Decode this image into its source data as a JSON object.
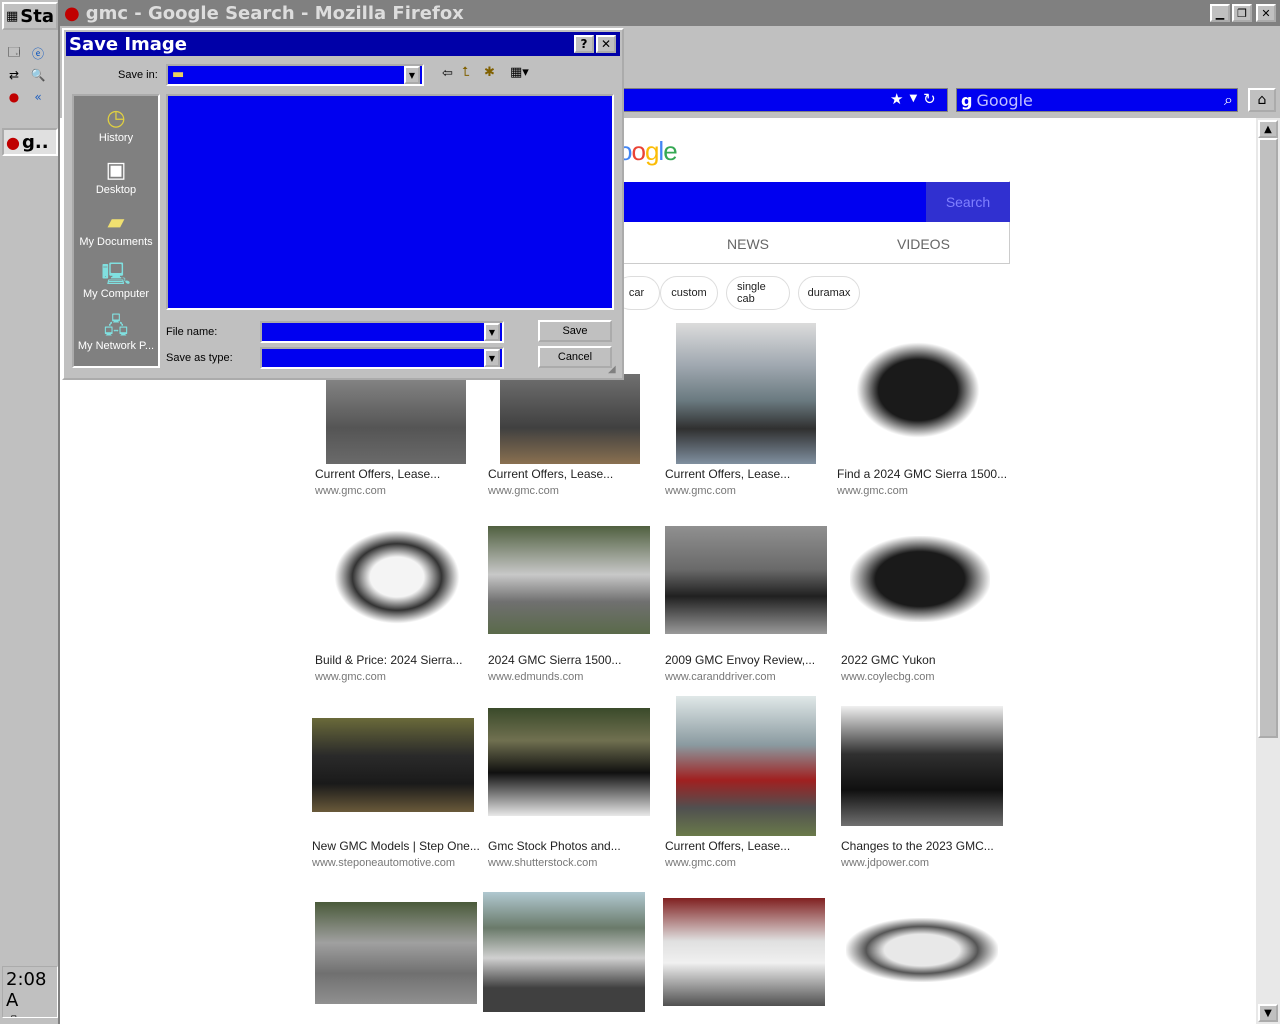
{
  "taskbar": {
    "start_label": "Sta",
    "task_label": "g..",
    "clock": "2:08 A"
  },
  "browser": {
    "window_title": "gmc - Google Search - Mozilla Firefox",
    "search_placeholder": "Google"
  },
  "google": {
    "logo": "Google",
    "search_button": "Search",
    "tabs": [
      "NEWS",
      "VIDEOS"
    ],
    "chips": [
      "car",
      "custom",
      "single cab",
      "duramax"
    ],
    "results": [
      {
        "caption": "Current Offers, Lease...",
        "domain": "www.gmc.com"
      },
      {
        "caption": "Current Offers, Lease...",
        "domain": "www.gmc.com"
      },
      {
        "caption": "Current Offers, Lease...",
        "domain": "www.gmc.com"
      },
      {
        "caption": "Find a 2024 GMC Sierra 1500...",
        "domain": "www.gmc.com"
      },
      {
        "caption": "Build & Price: 2024 Sierra...",
        "domain": "www.gmc.com"
      },
      {
        "caption": "2024 GMC Sierra 1500...",
        "domain": "www.edmunds.com"
      },
      {
        "caption": "2009 GMC Envoy Review,...",
        "domain": "www.caranddriver.com"
      },
      {
        "caption": "2022 GMC Yukon",
        "domain": "www.coylecbg.com"
      },
      {
        "caption": "New GMC Models | Step One...",
        "domain": "www.steponeautomotive.com"
      },
      {
        "caption": "Gmc Stock Photos and...",
        "domain": "www.shutterstock.com"
      },
      {
        "caption": "Current Offers, Lease...",
        "domain": "www.gmc.com"
      },
      {
        "caption": "Changes to the 2023 GMC...",
        "domain": "www.jdpower.com"
      }
    ]
  },
  "dialog": {
    "title": "Save Image",
    "help": "?",
    "close": "✕",
    "save_in_label": "Save in:",
    "places": [
      "History",
      "Desktop",
      "My Documents",
      "My Computer",
      "My Network P..."
    ],
    "file_name_label": "File name:",
    "save_as_type_label": "Save as type:",
    "save_button": "Save",
    "cancel_button": "Cancel"
  }
}
